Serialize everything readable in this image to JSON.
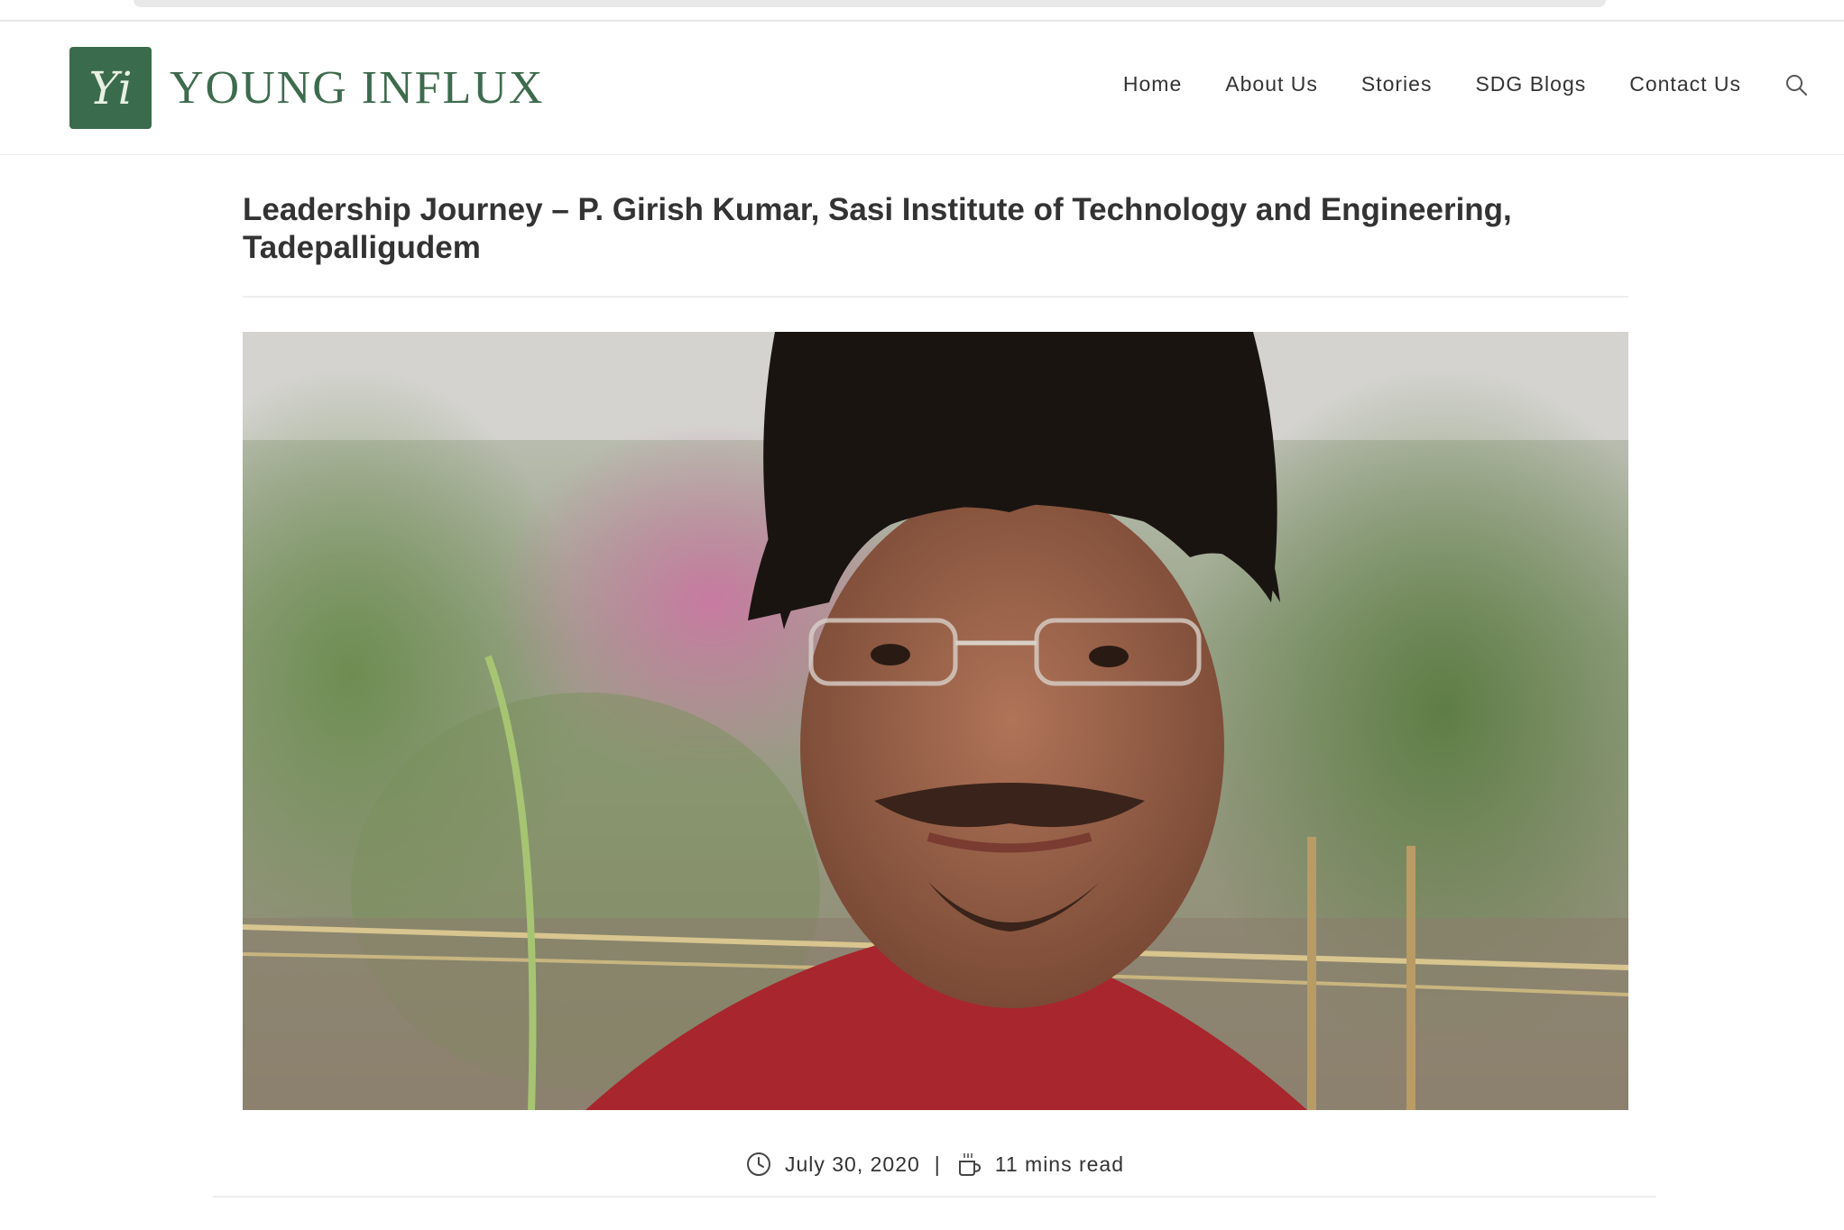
{
  "site": {
    "logo_monogram": "Yi",
    "logo_text": "YOUNG INFLUX"
  },
  "nav": {
    "items": [
      {
        "label": "Home"
      },
      {
        "label": "About Us"
      },
      {
        "label": "Stories"
      },
      {
        "label": "SDG Blogs"
      },
      {
        "label": "Contact Us"
      }
    ],
    "search_icon": "search-icon"
  },
  "post": {
    "title": "Leadership Journey – P. Girish Kumar, Sasi Institute of Technology and Engineering, Tadepalligudem",
    "date": "July 30, 2020",
    "separator": "|",
    "read_time": "11 mins read",
    "date_icon": "clock-icon",
    "read_icon": "coffee-cup-icon"
  },
  "colors": {
    "brand_green": "#3a6b4c",
    "text": "#333333"
  }
}
